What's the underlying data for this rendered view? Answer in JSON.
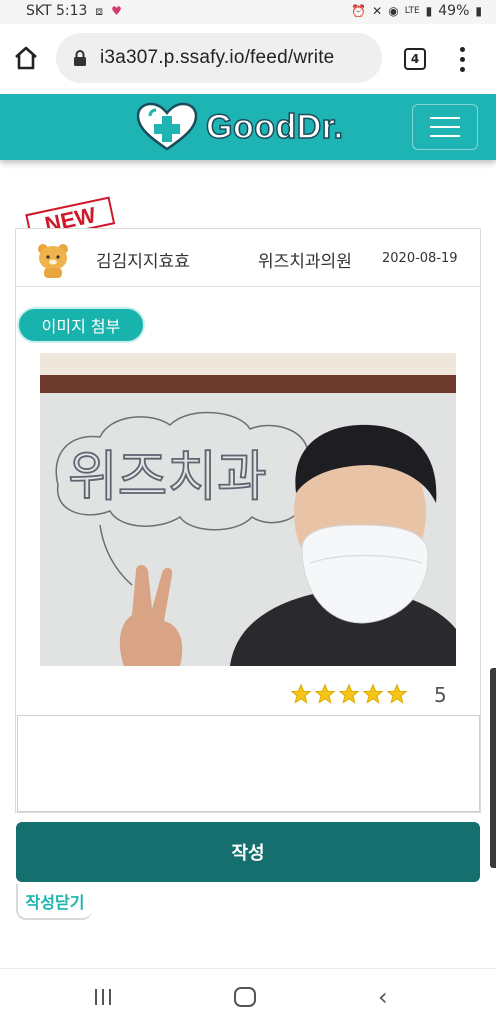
{
  "status_bar": {
    "carrier_time": "SKT 5:13",
    "battery": "49%",
    "network": "LTE"
  },
  "browser": {
    "url": "i3a307.p.ssafy.io/feed/write",
    "tab_count": "4"
  },
  "header": {
    "logo_text": "GoodDr.",
    "brand_color": "#1fb4b4"
  },
  "badge": {
    "text": "NEW"
  },
  "post": {
    "author": "김김지지효효",
    "hospital": "위즈치과의원",
    "date": "2020-08-19",
    "attach_label": "이미지 첨부",
    "photo_board_text": "위즈치과",
    "rating": 5,
    "rating_label": "5",
    "review_text": ""
  },
  "actions": {
    "submit_label": "작성",
    "close_label": "작성닫기",
    "submit_color": "#166f6f",
    "accent_color": "#19b3ad"
  },
  "icons": [
    "home-icon",
    "lock-icon",
    "tabs-icon",
    "more-icon",
    "menu-icon",
    "star-icon",
    "nav-recent-icon",
    "nav-home-icon",
    "nav-back-icon"
  ]
}
